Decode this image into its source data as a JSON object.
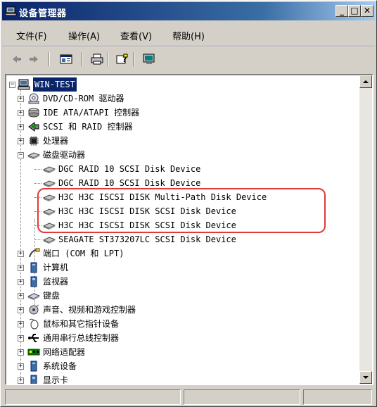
{
  "window": {
    "title": "设备管理器",
    "min_label": "_",
    "max_label": "□",
    "close_label": "✕"
  },
  "menu": {
    "file": "文件(F)",
    "action": "操作(A)",
    "view": "查看(V)",
    "help": "帮助(H)"
  },
  "toolbar": {
    "items": [
      "back-icon",
      "forward-icon",
      "properties-icon",
      "print-icon",
      "help-icon",
      "monitor-icon"
    ]
  },
  "tree": {
    "root": "WIN-TEST",
    "categories": [
      "DVD/CD-ROM 驱动器",
      "IDE ATA/ATAPI 控制器",
      "SCSI 和 RAID 控制器",
      "处理器",
      "磁盘驱动器"
    ],
    "disks": [
      "DGC RAID 10 SCSI Disk Device",
      "DGC RAID 10 SCSI Disk Device",
      "H3C H3C ISCSI DISK  Multi-Path Disk Device",
      "H3C H3C ISCSI DISK SCSI Disk Device",
      "H3C H3C ISCSI DISK SCSI Disk Device",
      "SEAGATE ST373207LC SCSI Disk Device"
    ],
    "categories_after": [
      "端口 (COM 和 LPT)",
      "计算机",
      "监视器",
      "键盘",
      "声音、视频和游戏控制器",
      "鼠标和其它指针设备",
      "通用串行总线控制器",
      "网络适配器",
      "系统设备",
      "显示卡"
    ]
  },
  "colors": {
    "highlight_box": "#e03a3a",
    "selection": "#0a246a",
    "titlebar": "#0a246a"
  }
}
